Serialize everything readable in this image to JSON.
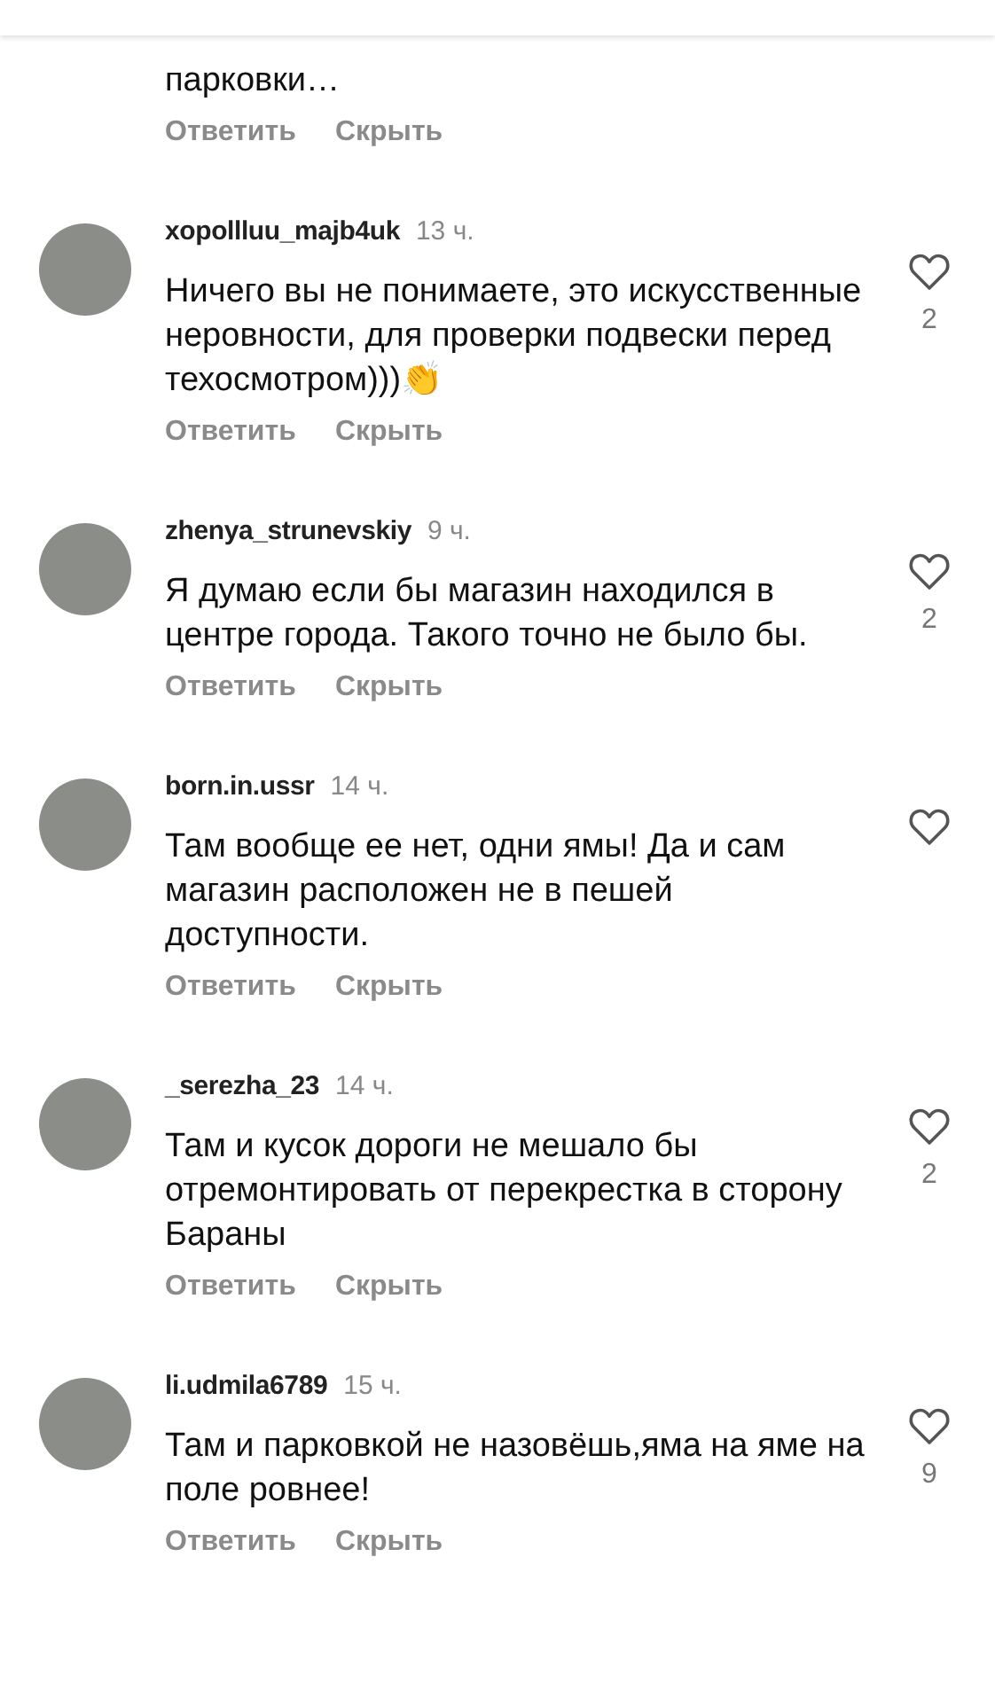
{
  "comments": [
    {
      "text": "парковки…",
      "actions": [
        "Ответить",
        "Скрыть"
      ]
    },
    {
      "username": "xopollluu_majb4uk",
      "time": "13 ч.",
      "text": "Ничего вы не понимаете, это искусственные неровности, для проверки подвески перед техосмотром)))👏",
      "actions": [
        "Ответить",
        "Скрыть"
      ],
      "likes": "2"
    },
    {
      "username": "zhenya_strunevskiy",
      "time": "9 ч.",
      "text": "Я думаю если бы магазин находился в центре города. Такого точно не было бы.",
      "actions": [
        "Ответить",
        "Скрыть"
      ],
      "likes": "2"
    },
    {
      "username": "born.in.ussr",
      "time": "14 ч.",
      "text": "Там вообще ее нет, одни ямы! Да и сам магазин расположен не в пешей доступности.",
      "actions": [
        "Ответить",
        "Скрыть"
      ]
    },
    {
      "username": "_serezha_23",
      "time": "14 ч.",
      "text": "Там и кусок дороги не мешало бы отремонтировать от перекрестка в сторону Бараны",
      "actions": [
        "Ответить",
        "Скрыть"
      ],
      "likes": "2"
    },
    {
      "username": "li.udmila6789",
      "time": "15 ч.",
      "text": "Там и парковкой не назовёшь,яма на яме на поле ровнее!",
      "actions": [
        "Ответить",
        "Скрыть"
      ],
      "likes": "9"
    }
  ]
}
